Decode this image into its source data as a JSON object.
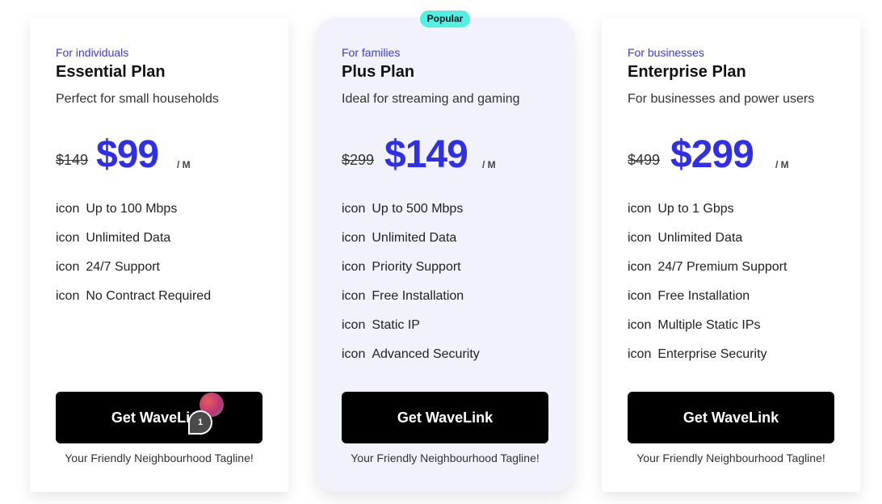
{
  "badge": "Popular",
  "plans": [
    {
      "audience": "For individuals",
      "name": "Essential Plan",
      "description": "Perfect for small households",
      "old_price": "$149",
      "price": "$99",
      "period": "/ M",
      "features": [
        {
          "icon": "icon",
          "text": "Up to 100 Mbps"
        },
        {
          "icon": "icon",
          "text": "Unlimited Data"
        },
        {
          "icon": "icon",
          "text": "24/7 Support"
        },
        {
          "icon": "icon",
          "text": "No Contract Required"
        }
      ],
      "cta": "Get WaveLink",
      "tagline": "Your Friendly Neighbourhood Tagline!"
    },
    {
      "audience": "For families",
      "name": "Plus Plan",
      "description": "Ideal for streaming and gaming",
      "old_price": "$299",
      "price": "$149",
      "period": "/ M",
      "features": [
        {
          "icon": "icon",
          "text": "Up to 500 Mbps"
        },
        {
          "icon": "icon",
          "text": "Unlimited Data"
        },
        {
          "icon": "icon",
          "text": "Priority Support"
        },
        {
          "icon": "icon",
          "text": "Free Installation"
        },
        {
          "icon": "icon",
          "text": "Static IP"
        },
        {
          "icon": "icon",
          "text": "Advanced Security"
        }
      ],
      "cta": "Get WaveLink",
      "tagline": "Your Friendly Neighbourhood Tagline!"
    },
    {
      "audience": "For businesses",
      "name": "Enterprise Plan",
      "description": "For businesses and power users",
      "old_price": "$499",
      "price": "$299",
      "period": "/ M",
      "features": [
        {
          "icon": "icon",
          "text": "Up to 1 Gbps"
        },
        {
          "icon": "icon",
          "text": "Unlimited Data"
        },
        {
          "icon": "icon",
          "text": "24/7 Premium Support"
        },
        {
          "icon": "icon",
          "text": "Free Installation"
        },
        {
          "icon": "icon",
          "text": "Multiple Static IPs"
        },
        {
          "icon": "icon",
          "text": "Enterprise Security"
        }
      ],
      "cta": "Get WaveLink",
      "tagline": "Your Friendly Neighbourhood Tagline!"
    }
  ],
  "cursor_marker": "1",
  "colors": {
    "accent": "#2f2fe8",
    "audience": "#3a3ae0",
    "badge": "#52f0e4",
    "button": "#000000",
    "highlight_card": "#f2f2fc"
  }
}
